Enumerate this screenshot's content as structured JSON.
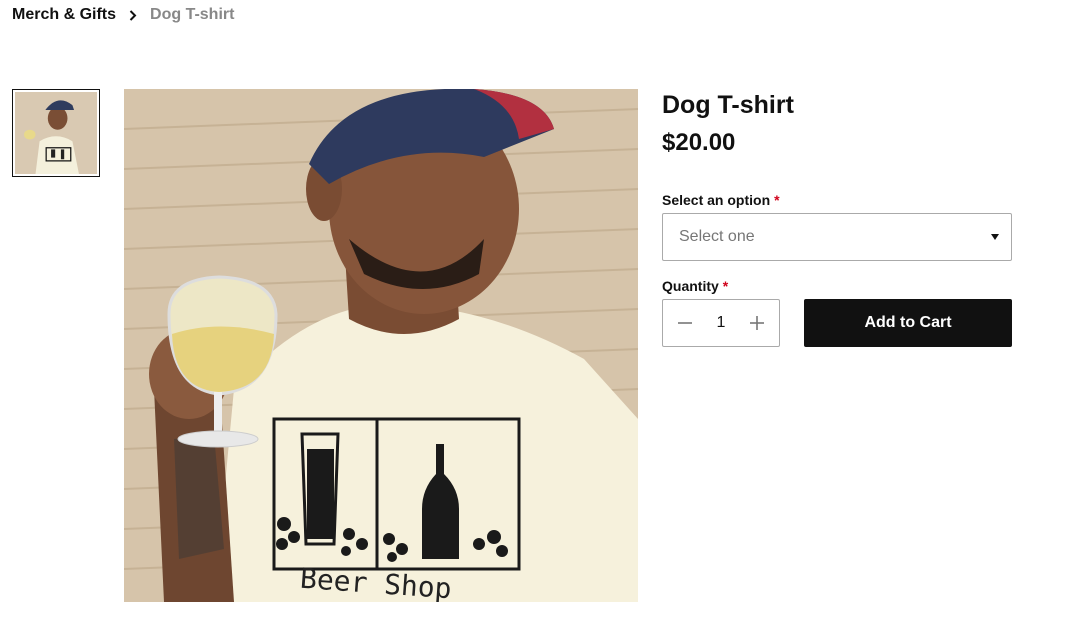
{
  "breadcrumb": {
    "parent": "Merch & Gifts",
    "current": "Dog T-shirt"
  },
  "icons": {
    "separator": "chevron-right-icon",
    "minus": "minus-icon",
    "plus": "plus-icon",
    "dropdown": "caret-down-icon"
  },
  "product": {
    "title": "Dog T-shirt",
    "price": "$20.00",
    "option_label": "Select an option",
    "option_placeholder": "Select one",
    "quantity_label": "Quantity",
    "quantity": "1",
    "required_mark": "*",
    "add_to_cart": "Add to Cart",
    "shirt_print": "Beer Shop"
  },
  "colors": {
    "required": "#d0021b",
    "button_bg": "#111111",
    "muted_text": "#888888"
  }
}
